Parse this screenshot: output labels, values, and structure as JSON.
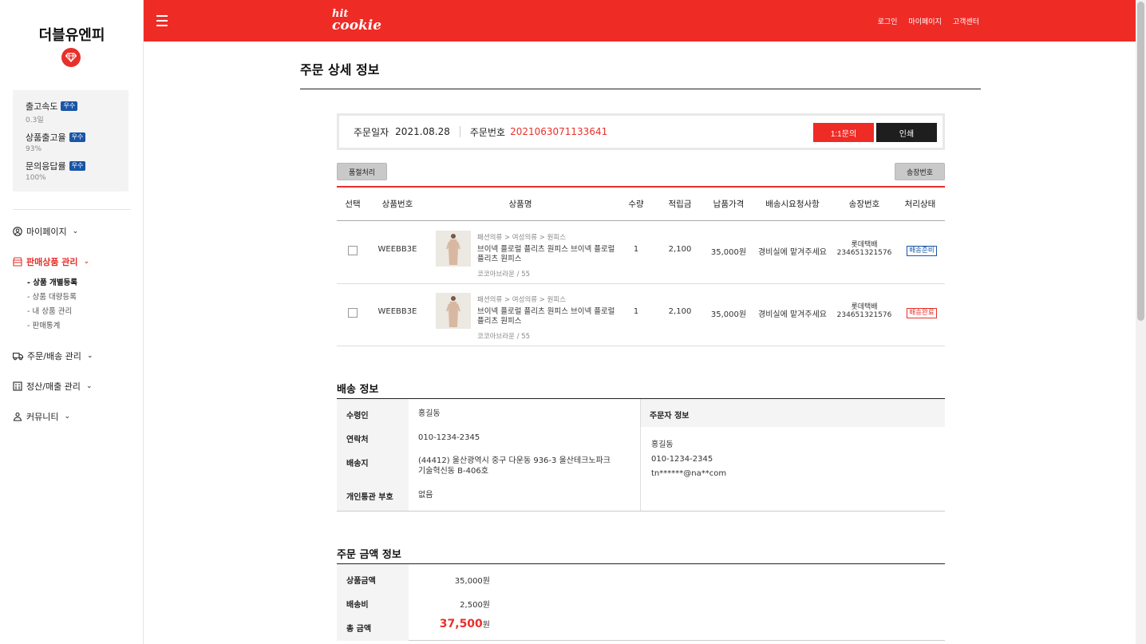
{
  "sidebar": {
    "shop_name": "더블유엔피",
    "stats": [
      {
        "title": "출고속도",
        "badge": "우수",
        "value": "0.3일"
      },
      {
        "title": "상품출고율",
        "badge": "우수",
        "value": "93%"
      },
      {
        "title": "문의응답률",
        "badge": "우수",
        "value": "100%"
      }
    ],
    "menu": {
      "mypage": "마이페이지",
      "sales": "판매상품 관리",
      "sales_sub": [
        "- 상품 개별등록",
        "- 상품 대량등록",
        "- 내 상품 관리",
        "- 판매통계"
      ],
      "order": "주문/배송 관리",
      "settle": "정산/매출 관리",
      "community": "커뮤니티"
    }
  },
  "header": {
    "logo_line1": "hit",
    "logo_line2": "cookie",
    "links": [
      "로그인",
      "마이페이지",
      "고객센터"
    ]
  },
  "page": {
    "title": "주문 상세 정보",
    "order_date_label": "주문일자",
    "order_date": "2021.08.28",
    "order_no_label": "주문번호",
    "order_no": "2021063071133641",
    "inquiry_btn": "1:1문의",
    "print_btn": "인쇄",
    "soldout_btn": "품절처리",
    "invoice_btn": "송장번호"
  },
  "table": {
    "headers": [
      "선택",
      "상품번호",
      "상품명",
      "수량",
      "적립금",
      "납품가격",
      "배송시요청사항",
      "송장번호",
      "처리상태"
    ],
    "rows": [
      {
        "product_no": "WEEBB3E",
        "category": "패션의류 > 여성의류 > 원피스",
        "name": "브이넥 플로럴 플리츠 원피스 브이넥 플로럴 플리츠 원피스",
        "option": "코코아브라운 / 55",
        "qty": "1",
        "points": "2,100",
        "price": "35,000원",
        "request": "경비실에 맡겨주세요",
        "carrier": "롯데택배",
        "invoice": "234651321576",
        "status": "배송준비",
        "status_color": "#1a55a6"
      },
      {
        "product_no": "WEEBB3E",
        "category": "패션의류 > 여성의류 > 원피스",
        "name": "브이넥 플로럴 플리츠 원피스 브이넥 플로럴 플리츠 원피스",
        "option": "코코아브라운 / 55",
        "qty": "1",
        "points": "2,100",
        "price": "35,000원",
        "request": "경비실에 맡겨주세요",
        "carrier": "롯데택배",
        "invoice": "234651321576",
        "status": "배송완료",
        "status_color": "#e8302a"
      }
    ]
  },
  "shipping": {
    "title": "배송 정보",
    "recipient_label": "수령인",
    "recipient": "홍길동",
    "contact_label": "연락처",
    "contact": "010-1234-2345",
    "address_label": "배송지",
    "address_line1": "(44412) 울산광역시 중구 다운동 936-3 울산테크노파크",
    "address_line2": "기술혁신동 B-406호",
    "customs_label": "개인통관 부호",
    "customs": "없음",
    "buyer_title": "주문자 정보",
    "buyer_name": "홍길동",
    "buyer_phone": "010-1234-2345",
    "buyer_email": "tn******@na**com"
  },
  "amount": {
    "title": "주문 금액 정보",
    "product_label": "상품금액",
    "product": "35,000원",
    "shipping_label": "배송비",
    "shipping": "2,500원",
    "total_label": "총 금액",
    "total": "37,500",
    "total_unit": "원"
  },
  "colors": {
    "brand_red": "#ef2b26",
    "badge_blue": "#1a55a6"
  }
}
